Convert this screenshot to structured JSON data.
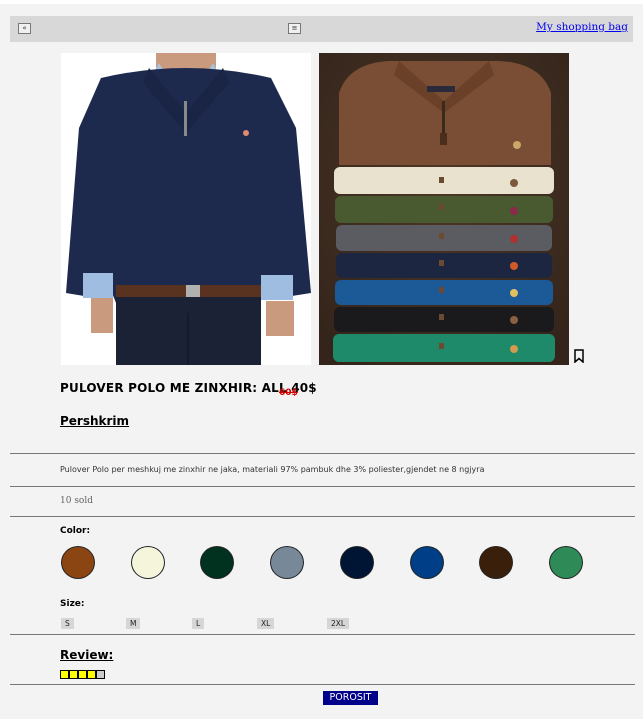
{
  "topbar": {
    "back_icon": "back-arrow-icon",
    "menu_icon": "menu-icon",
    "back_glyph": "«",
    "menu_glyph": "≡",
    "bag_link": "My shopping bag"
  },
  "product": {
    "title": "PULOVER POLO ME ZINXHIR: ALL 40$",
    "old_price": "60$",
    "bookmark_icon": "bookmark-icon",
    "images": [
      "model-wearing-navy-pullover",
      "stack-of-pullovers-in-eight-colors"
    ]
  },
  "description": {
    "heading": "Pershkrim",
    "text": "Pulover Polo per meshkuj me zinxhir ne jaka, materiali 97% pambuk dhe 3% poliester,gjendet ne 8 ngjyra"
  },
  "sold": "10 sold",
  "color": {
    "label": "Color:",
    "swatches": [
      "#8b4513",
      "#f5f5dc",
      "#013220",
      "#778899",
      "#001433",
      "#003f87",
      "#3a1f0b",
      "#2e8b57"
    ]
  },
  "size": {
    "label": "Size:",
    "options": [
      "S",
      "M",
      "L",
      "XL",
      "2XL"
    ]
  },
  "review": {
    "heading": "Review:",
    "rating": 4,
    "max": 5,
    "filled_color": "#ffff00",
    "empty_color": "#cccccc"
  },
  "order_button": "POROSIT"
}
